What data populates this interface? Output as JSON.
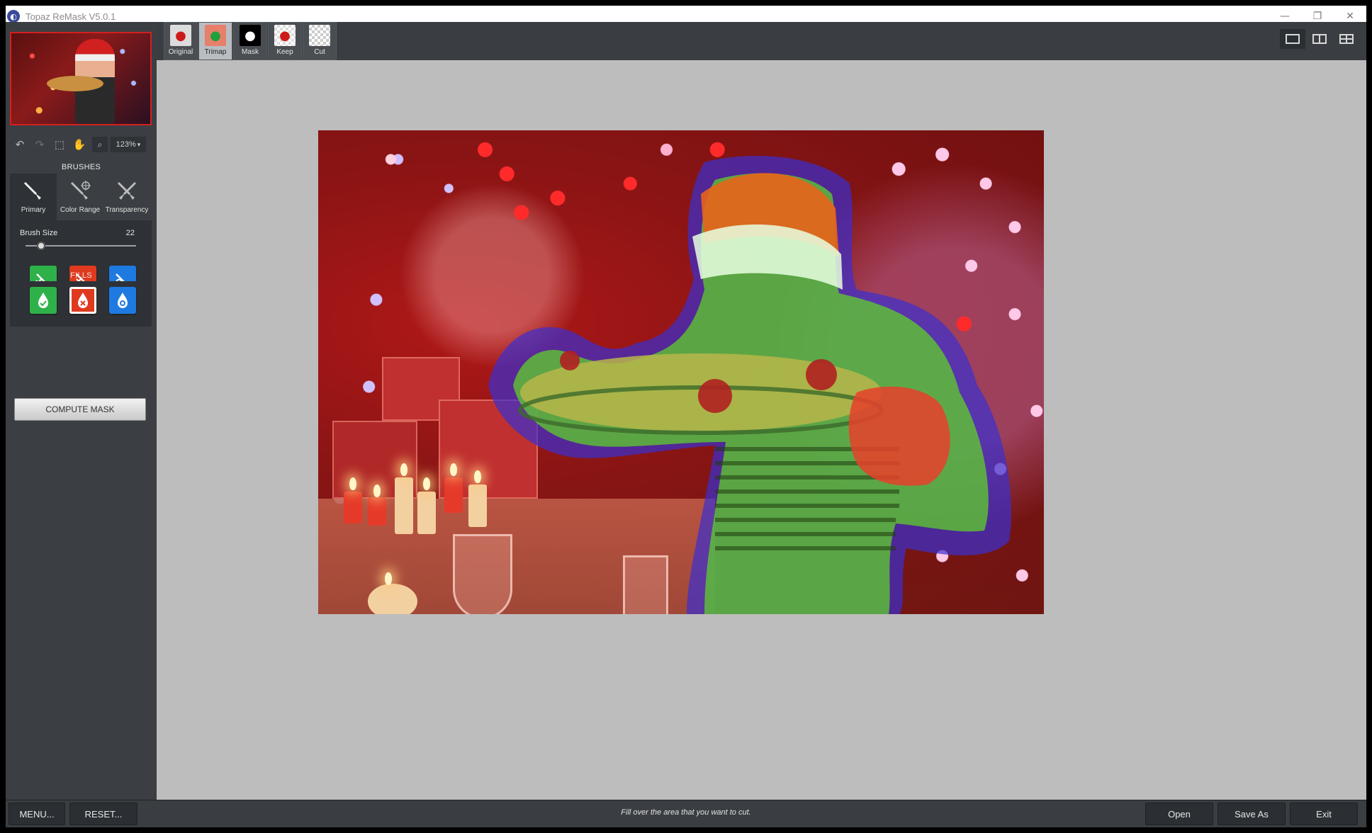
{
  "window": {
    "title": "Topaz ReMask V5.0.1",
    "controls": [
      "—",
      "❐",
      "✕"
    ]
  },
  "toolbar": {
    "zoom": "123%",
    "zoom_caret": "▾",
    "undo_icon": "↶",
    "redo_icon": "↷",
    "marquee_icon": "⬚",
    "hand_icon": "✋",
    "magnifier_icon": "⌕"
  },
  "brushes": {
    "title": "BRUSHES",
    "tabs": [
      {
        "label": "Primary",
        "icon": "brush-icon",
        "active": true
      },
      {
        "label": "Color Range",
        "icon": "color-range-brush-icon"
      },
      {
        "label": "Transparency",
        "icon": "transparency-brush-icon"
      }
    ],
    "size_label": "Brush Size",
    "size_value": "22",
    "size_fraction": 0.1
  },
  "fills": {
    "title": "FILLS"
  },
  "compute_mask": "COMPUTE MASK",
  "views": [
    {
      "label": "Original",
      "active": false
    },
    {
      "label": "Trimap",
      "active": true
    },
    {
      "label": "Mask",
      "active": false
    },
    {
      "label": "Keep",
      "active": false
    },
    {
      "label": "Cut",
      "active": false
    }
  ],
  "bottom": {
    "menu": "MENU...",
    "reset": "RESET...",
    "hint": "Fill over the area that you want to cut.",
    "open": "Open",
    "save_as": "Save As",
    "exit": "Exit"
  },
  "colors": {
    "keep": "#2fb14a",
    "cut": "#e03a1e",
    "compute": "#1e7ae0",
    "thumb_border": "#d32020"
  }
}
